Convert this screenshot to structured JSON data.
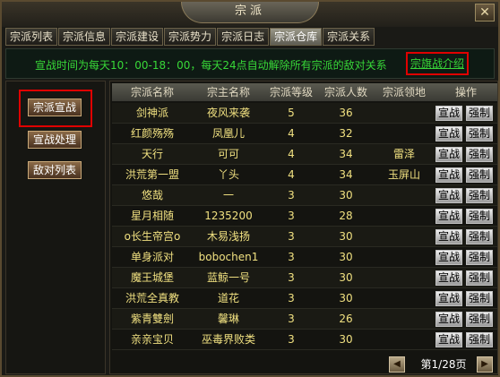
{
  "window": {
    "title": "宗派",
    "close_icon": "close-icon"
  },
  "tabs": [
    "宗派列表",
    "宗派信息",
    "宗派建设",
    "宗派势力",
    "宗派日志",
    "宗派仓库",
    "宗派关系"
  ],
  "active_tab": 5,
  "notice": {
    "text": "宣战时间为每天10：00-18：00，每天24点自动解除所有宗派的敌对关系",
    "link": "宗旗战介绍"
  },
  "sidebar": {
    "declare_war": "宗派宣战",
    "war_handling": "宣战处理",
    "enemy_list": "敌对列表"
  },
  "table": {
    "headers": [
      "宗派名称",
      "宗主名称",
      "宗派等级",
      "宗派人数",
      "宗派领地",
      "操作"
    ],
    "action_declare": "宣战",
    "action_force": "强制",
    "rows": [
      {
        "name": "剑神派",
        "master": "夜风来袭",
        "level": "5",
        "count": "36",
        "territory": ""
      },
      {
        "name": "红颜殇殇",
        "master": "凤凰儿",
        "level": "4",
        "count": "32",
        "territory": ""
      },
      {
        "name": "天行",
        "master": "可可",
        "level": "4",
        "count": "34",
        "territory": "雷泽"
      },
      {
        "name": "洪荒第一盟",
        "master": "丫头",
        "level": "4",
        "count": "34",
        "territory": "玉屏山"
      },
      {
        "name": "悠哉",
        "master": "一",
        "level": "3",
        "count": "30",
        "territory": ""
      },
      {
        "name": "星月相随",
        "master": "1235200",
        "level": "3",
        "count": "28",
        "territory": ""
      },
      {
        "name": "o长生帝宫o",
        "master": "木易浅扬",
        "level": "3",
        "count": "30",
        "territory": ""
      },
      {
        "name": "单身派对",
        "master": "bobochen1",
        "level": "3",
        "count": "30",
        "territory": ""
      },
      {
        "name": "魔王城堡",
        "master": "蓝鲸一号",
        "level": "3",
        "count": "30",
        "territory": ""
      },
      {
        "name": "洪荒全真教",
        "master": "道花",
        "level": "3",
        "count": "30",
        "territory": ""
      },
      {
        "name": "紫青雙劍",
        "master": "馨琳",
        "level": "3",
        "count": "26",
        "territory": ""
      },
      {
        "name": "亲亲宝贝",
        "master": "巫毒界败类",
        "level": "3",
        "count": "30",
        "territory": ""
      }
    ]
  },
  "pager": {
    "text": "第1/28页"
  },
  "colors": {
    "highlight": "#e00000",
    "notice": "#38d838",
    "cell_text": "#f0e080"
  }
}
